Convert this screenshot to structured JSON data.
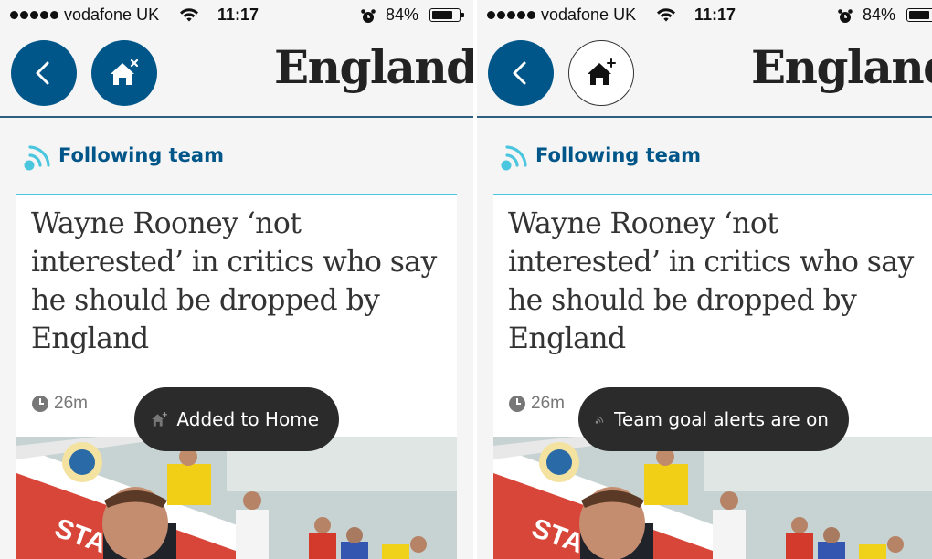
{
  "panels": [
    {
      "status": {
        "carrier": "vodafone UK",
        "time": "11:17",
        "battery_pct": "84%",
        "battery_level": 0.84
      },
      "header": {
        "title": "England",
        "back_icon": "chevron-left-icon",
        "home_icon": "home-remove-icon"
      },
      "following": {
        "label": "Following team",
        "icon": "feed-icon"
      },
      "article": {
        "headline": "Wayne Rooney ‘not interested’ in critics who say he should be dropped by England",
        "time_ago": "26m",
        "photo_text": "STA"
      },
      "toast": {
        "label": "Added to Home",
        "icon": "home-add-icon"
      }
    },
    {
      "status": {
        "carrier": "vodafone UK",
        "time": "11:17",
        "battery_pct": "84%",
        "battery_level": 0.84
      },
      "header": {
        "title": "England",
        "back_icon": "chevron-left-icon",
        "home_icon": "home-add-icon"
      },
      "following": {
        "label": "Following team",
        "icon": "feed-icon"
      },
      "article": {
        "headline": "Wayne Rooney ‘not interested’ in critics who say he should be dropped by England",
        "time_ago": "26m",
        "photo_text": "STA"
      },
      "toast": {
        "label": "Team goal alerts are on",
        "icon": "feed-icon"
      }
    }
  ],
  "colors": {
    "brand_blue": "#005689",
    "accent_cyan": "#4bc6df",
    "toast_bg": "#2b2b2b",
    "headline": "#333333"
  }
}
